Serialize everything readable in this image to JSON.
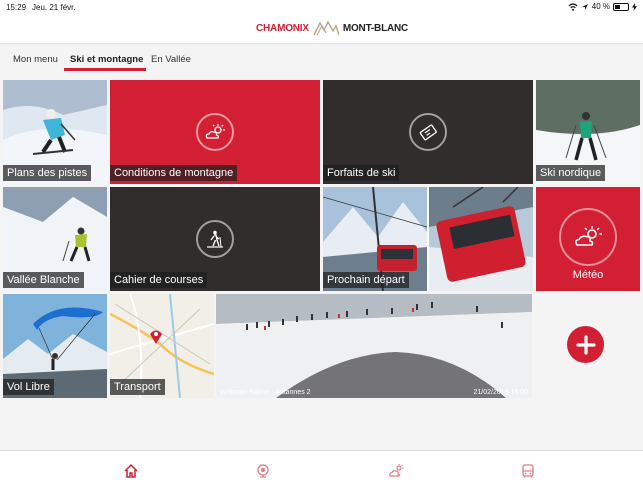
{
  "status": {
    "time": "15:29",
    "date": "Jeu. 21 févr.",
    "battery": "40 %",
    "battery_level": 0.4
  },
  "header": {
    "logo_word1": "CHAMONIX",
    "logo_word2": "MONT-BLANC"
  },
  "tabs": [
    {
      "label": "Mon menu",
      "active": false
    },
    {
      "label": "Ski et montagne",
      "active": true
    },
    {
      "label": "En Vallée",
      "active": false
    }
  ],
  "tiles": {
    "plans": "Plans des pistes",
    "conditions": "Conditions de montagne",
    "forfaits": "Forfaits de ski",
    "nordique": "Ski nordique",
    "vallee": "Vallée Blanche",
    "cahier": "Cahier de courses",
    "prochain": "Prochain départ",
    "meteo": "Météo",
    "vol": "Vol Libre",
    "transport": "Transport"
  },
  "webcam": {
    "name": "Webcam Balme - Autannes 2",
    "timestamp": "21/02/2019 15:00"
  },
  "colors": {
    "accent": "#d21f34",
    "dark_tile": "#302d2c",
    "background": "#f4f4f4"
  },
  "bottom_nav": [
    {
      "icon": "home-icon",
      "active": true
    },
    {
      "icon": "webcam-icon",
      "active": false
    },
    {
      "icon": "weather-icon",
      "active": false
    },
    {
      "icon": "bus-icon",
      "active": false
    }
  ]
}
